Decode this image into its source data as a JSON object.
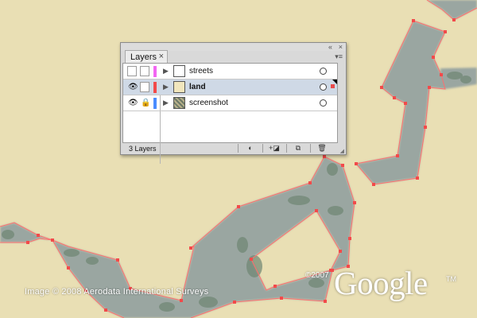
{
  "panel": {
    "tab_label": "Layers",
    "tab_close": "×",
    "collapse_btn": "«",
    "close_btn": "×",
    "menu_btn": "▾≡",
    "layers": [
      {
        "name": "streets",
        "visible": false,
        "locked": false,
        "color": "#f266f2",
        "selected": false,
        "thumb": "blank"
      },
      {
        "name": "land",
        "visible": true,
        "locked": false,
        "color": "#f24a4a",
        "selected": true,
        "thumb": "land"
      },
      {
        "name": "screenshot",
        "visible": true,
        "locked": true,
        "color": "#4a8cff",
        "selected": false,
        "thumb": "screenshot"
      }
    ],
    "eye_glyph": "👁",
    "lock_glyph": "🔒",
    "expand_glyph": "▶",
    "count_label": "3 Layers",
    "footer_buttons": [
      {
        "name": "make-clipping-mask-button",
        "glyph": "◐"
      },
      {
        "name": "create-sublayer-button",
        "glyph": "+◪"
      },
      {
        "name": "new-layer-button",
        "glyph": "⧉"
      },
      {
        "name": "delete-layer-button",
        "glyph": "🗑"
      }
    ]
  },
  "map": {
    "credit": "Image © 2008 Aerodata International Surveys",
    "copyright": "©2007",
    "logo_text": "Google",
    "tm": "TM",
    "road_color": "#9aa6a1",
    "outline_color": "#ff6e6e"
  }
}
